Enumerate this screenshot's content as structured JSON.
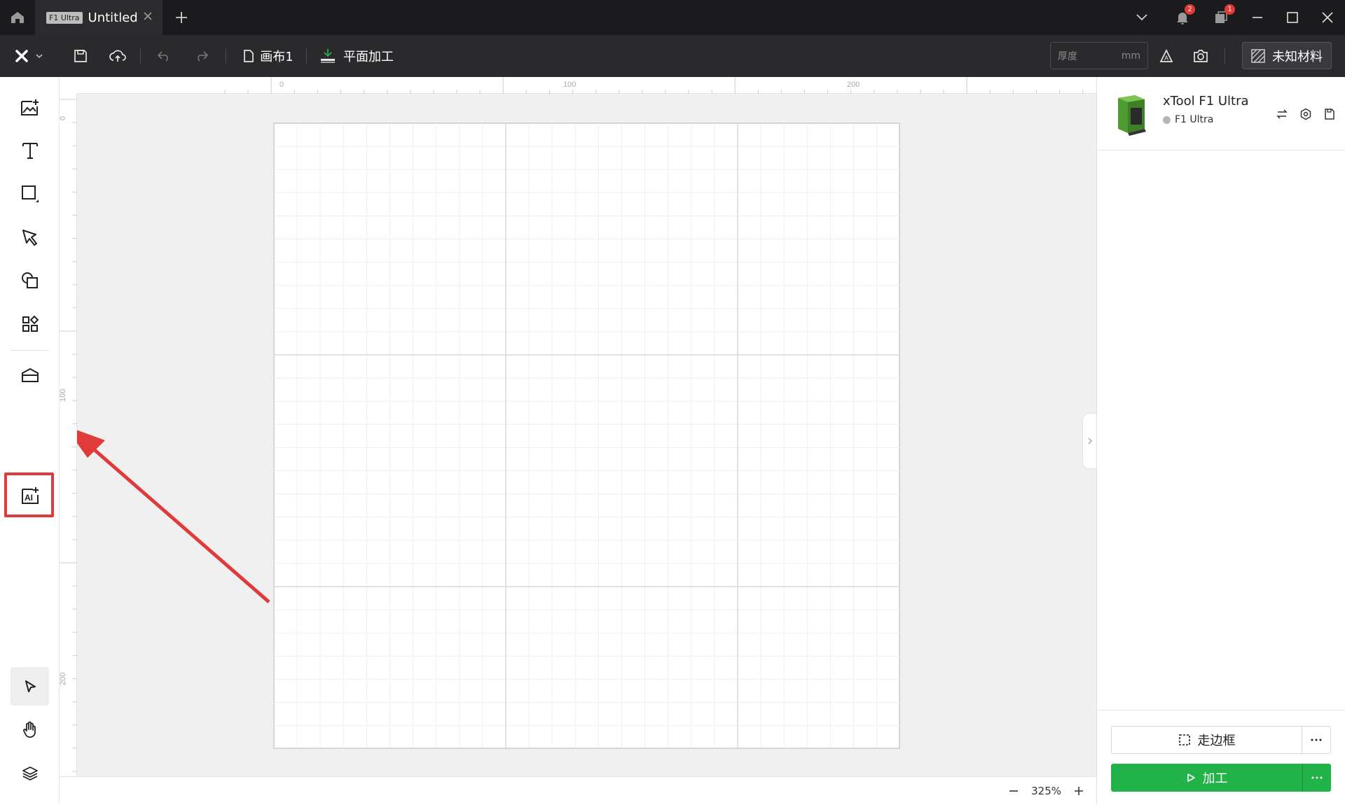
{
  "titlebar": {
    "tab_badge": "F1 Ultra",
    "tab_title": "Untitled",
    "notification_count": "2",
    "messages_count": "1"
  },
  "toolbar": {
    "canvas_name": "画布1",
    "mode": "平面加工",
    "thickness_placeholder": "厚度",
    "thickness_unit": "mm",
    "material": "未知材料"
  },
  "left_tools": [
    {
      "name": "image-icon"
    },
    {
      "name": "text-icon"
    },
    {
      "name": "rectangle-icon"
    },
    {
      "name": "pen-icon"
    },
    {
      "name": "shapes-icon"
    },
    {
      "name": "elements-icon"
    },
    {
      "name": "material-library-icon"
    },
    {
      "name": "ai-image-icon"
    },
    {
      "name": "select-arrow-icon"
    },
    {
      "name": "hand-icon"
    },
    {
      "name": "layers-icon"
    }
  ],
  "ruler": {
    "top_labels": [
      "0",
      "100",
      "200"
    ],
    "left_labels": [
      "0",
      "100",
      "200"
    ]
  },
  "statusbar": {
    "zoom": "325%"
  },
  "device": {
    "name": "xTool F1 Ultra",
    "model": "F1 Ultra",
    "status_color": "#b5b5b5"
  },
  "actions": {
    "frame_label": "走边框",
    "process_label": "加工",
    "process_color": "#21b34a"
  },
  "annotation": {
    "highlight_color": "#e03b3b"
  }
}
